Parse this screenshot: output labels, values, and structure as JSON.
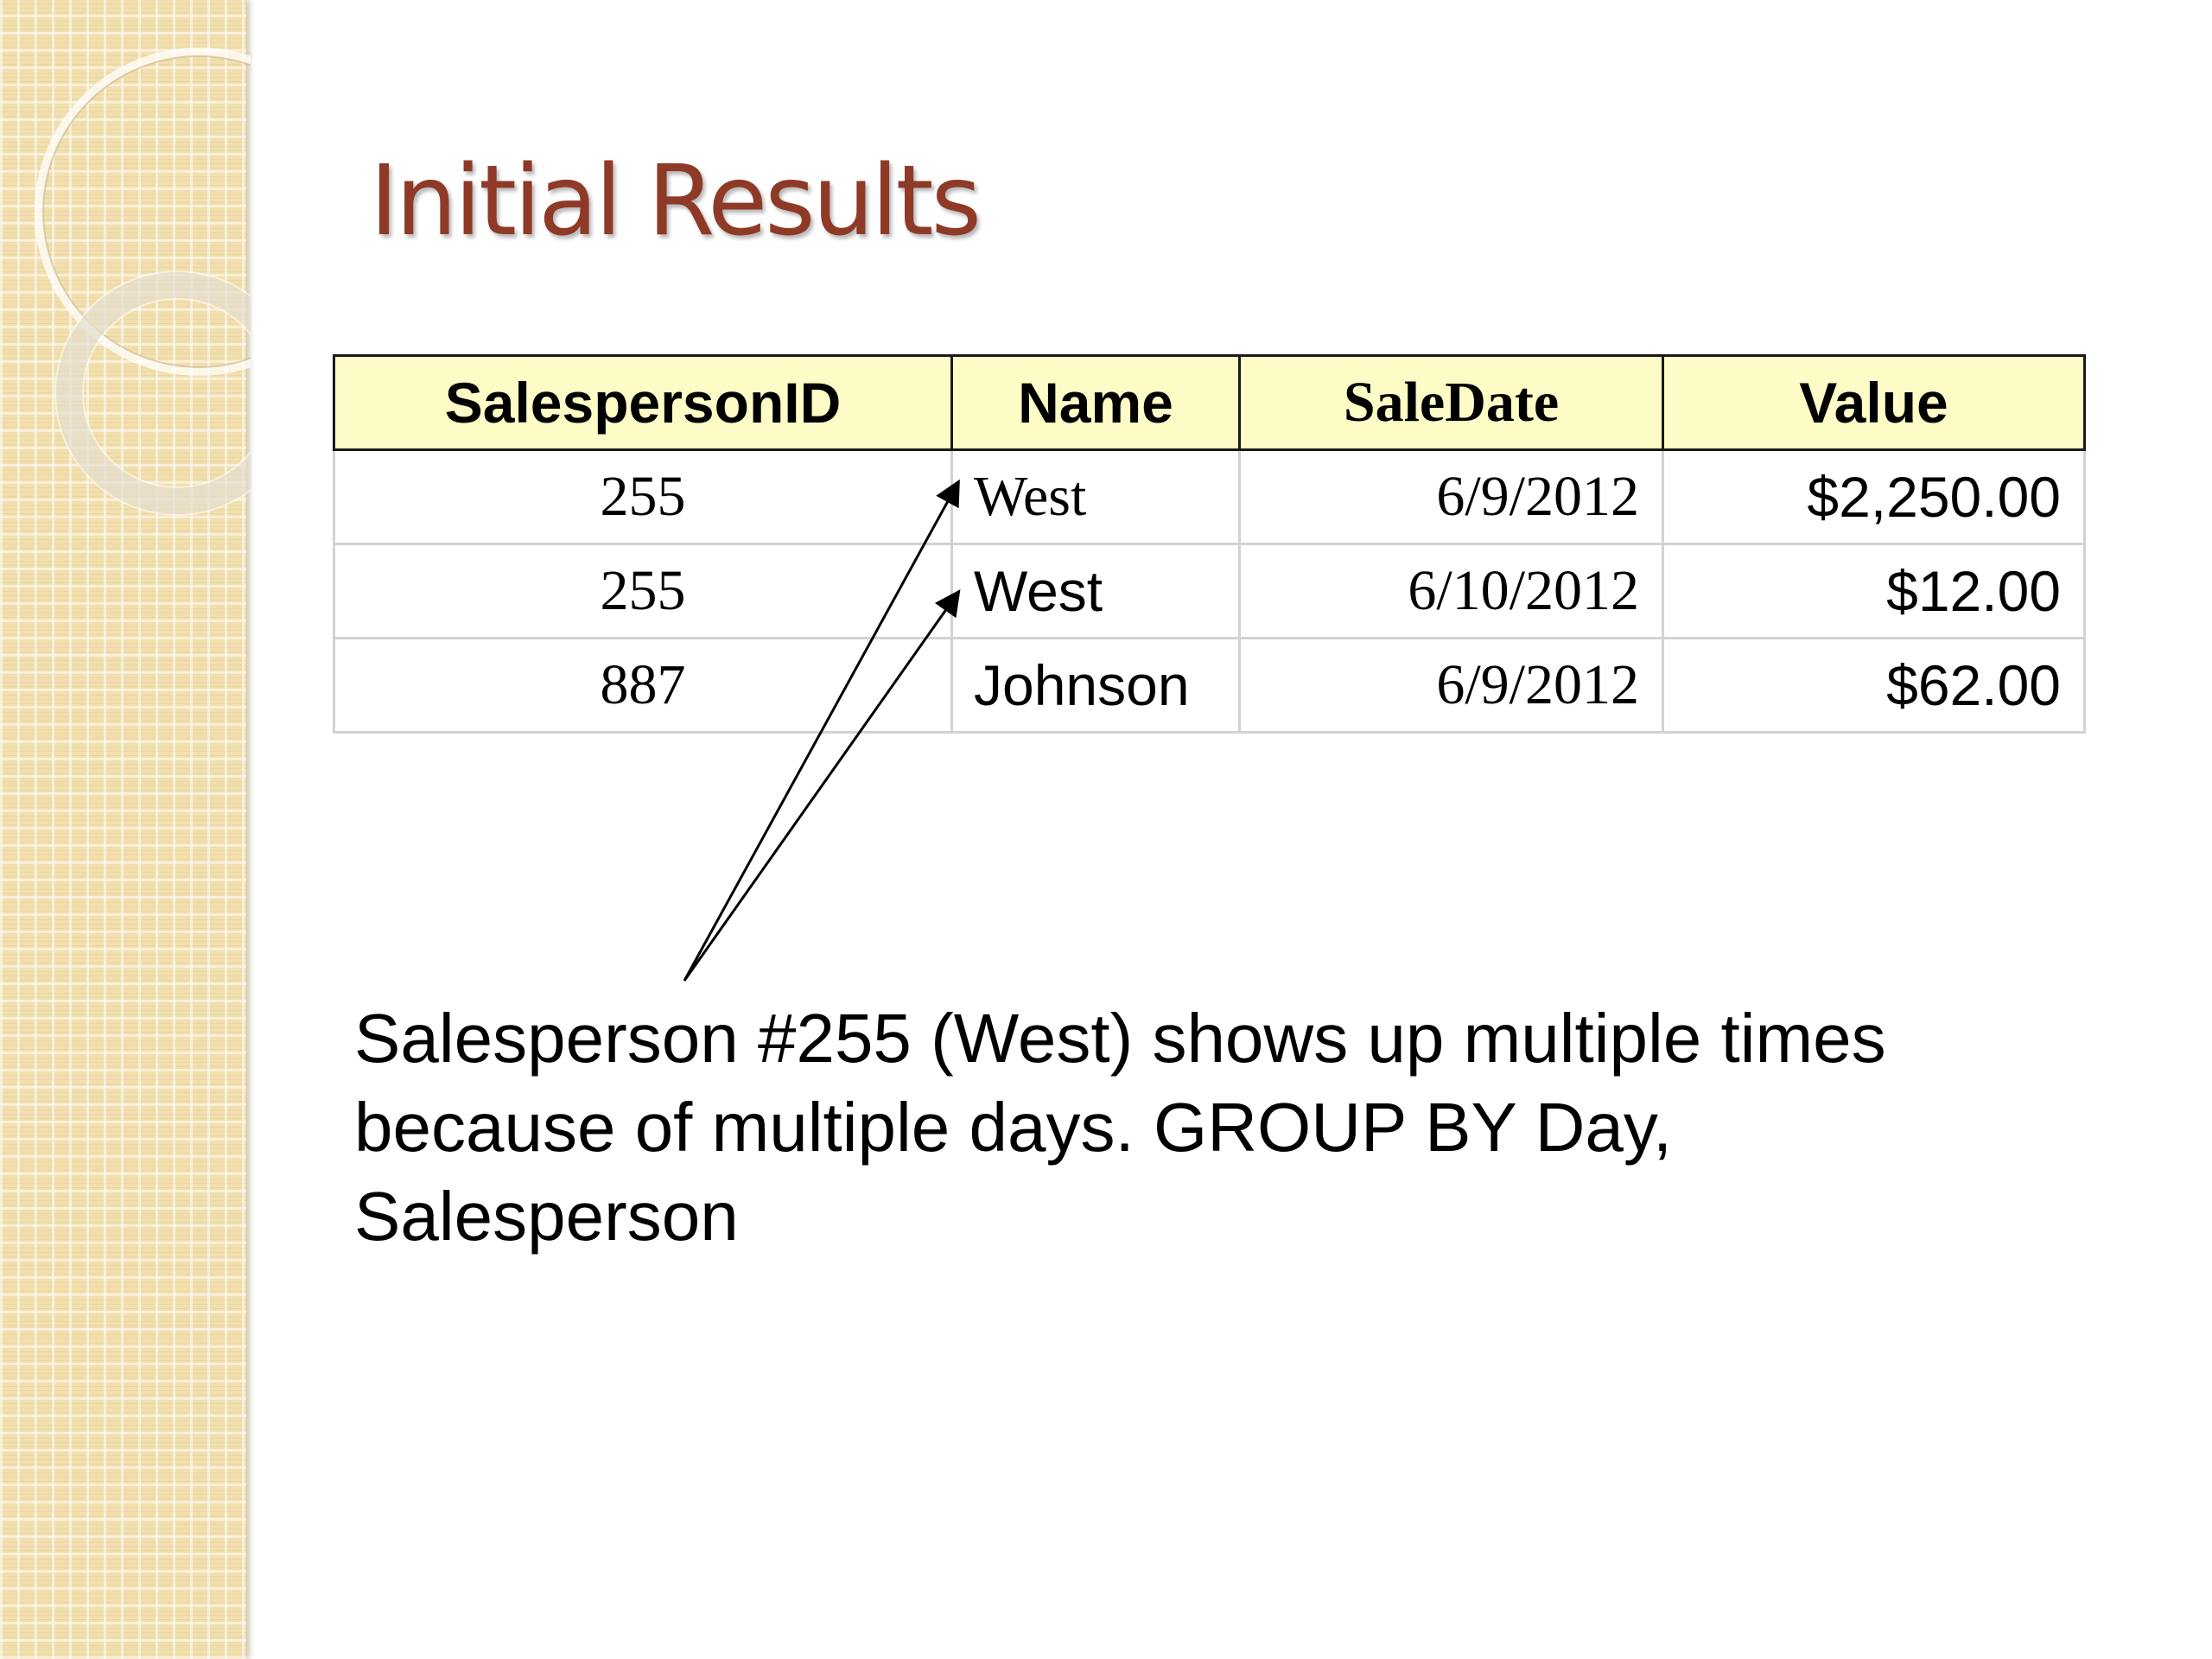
{
  "slide": {
    "title": "Initial Results",
    "table": {
      "headers": [
        "SalespersonID",
        "Name",
        "SaleDate",
        "Value"
      ],
      "rows": [
        [
          "255",
          "West",
          "6/9/2012",
          "$2,250.00"
        ],
        [
          "255",
          "West",
          "6/10/2012",
          "$12.00"
        ],
        [
          "887",
          "Johnson",
          "6/9/2012",
          "$62.00"
        ]
      ]
    },
    "note": "Salesperson #255 (West) shows up multiple times because of multiple days. GROUP BY Day, Salesperson"
  },
  "colors": {
    "title": "#8e3a26",
    "header_background": "#fefcc6",
    "left_band": "#f1dfae",
    "cell_border": "#d2d2d2"
  }
}
